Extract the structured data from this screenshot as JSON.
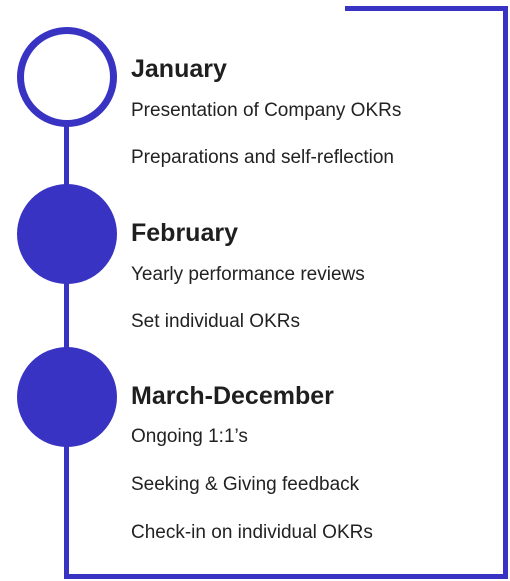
{
  "colors": {
    "accent": "#3833c2",
    "text": "#1f1f1f",
    "background": "#ffffff"
  },
  "timeline": [
    {
      "title": "January",
      "marker": "hollow-circle",
      "items": [
        "Presentation of Company OKRs",
        "Preparations and self-reflection"
      ]
    },
    {
      "title": "February",
      "marker": "filled-circle",
      "items": [
        "Yearly performance reviews",
        "Set individual OKRs"
      ]
    },
    {
      "title": "March-December",
      "marker": "filled-circle",
      "items": [
        "Ongoing 1:1’s",
        "Seeking & Giving feedback",
        "Check-in on individual OKRs"
      ]
    }
  ]
}
